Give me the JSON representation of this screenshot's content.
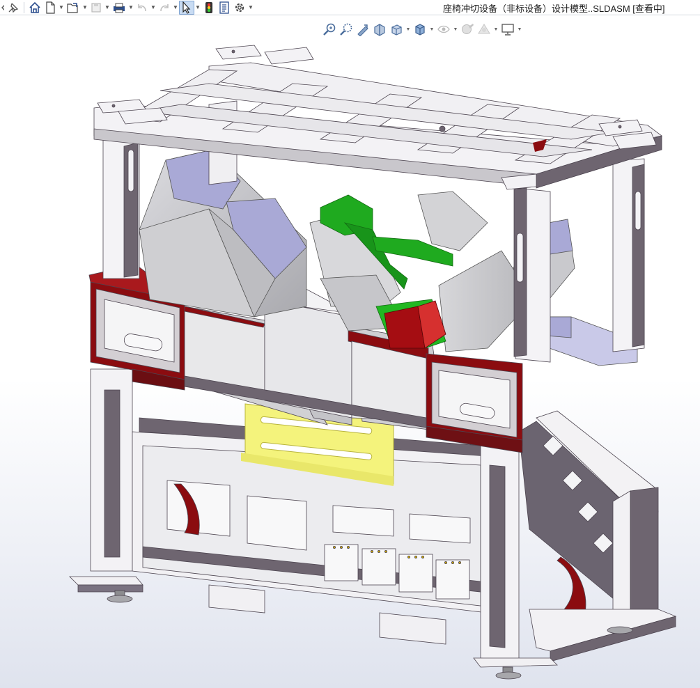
{
  "window": {
    "title": "座椅冲切设备（非标设备）设计模型..SLDASM [查看中]"
  },
  "toolbar": {
    "items": [
      {
        "name": "pin-icon"
      },
      {
        "name": "home-icon"
      },
      {
        "name": "new-document-icon"
      },
      {
        "name": "open-icon"
      },
      {
        "name": "save-icon"
      },
      {
        "name": "print-icon"
      },
      {
        "name": "undo-icon"
      },
      {
        "name": "redo-icon"
      },
      {
        "name": "select-icon"
      },
      {
        "name": "rebuild-icon"
      },
      {
        "name": "file-properties-icon"
      },
      {
        "name": "options-icon"
      }
    ]
  },
  "view_toolbar": {
    "items": [
      {
        "name": "zoom-to-fit-icon"
      },
      {
        "name": "zoom-to-area-icon"
      },
      {
        "name": "previous-view-icon"
      },
      {
        "name": "section-view-icon"
      },
      {
        "name": "view-orientation-icon"
      },
      {
        "name": "display-style-icon"
      },
      {
        "name": "hide-show-items-icon"
      },
      {
        "name": "edit-appearance-icon"
      },
      {
        "name": "view-settings-icon"
      }
    ]
  },
  "colors": {
    "frame": "#f1f0f3",
    "frame_shade": "#6e6570",
    "hopper": "#cfcfd3",
    "accent_red": "#8b0c10",
    "green_part": "#1faa1f",
    "yellow_plate": "#f4f37c",
    "blue_part": "#a9a9d6"
  }
}
